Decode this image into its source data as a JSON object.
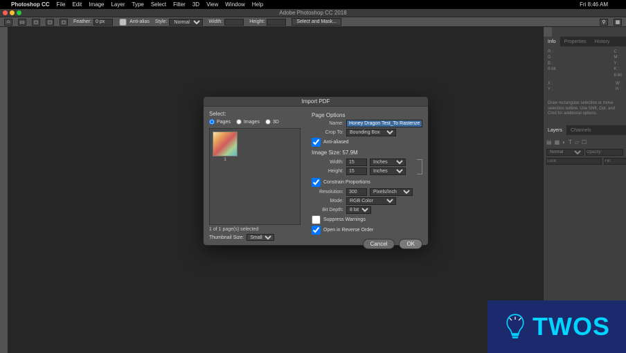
{
  "mac": {
    "apple": "",
    "app": "Photoshop CC",
    "menus": [
      "File",
      "Edit",
      "Image",
      "Layer",
      "Type",
      "Select",
      "Filter",
      "3D",
      "View",
      "Window",
      "Help"
    ],
    "right": [
      "",
      "",
      "",
      "",
      "",
      "",
      "Fri 8:46 AM",
      "",
      ""
    ]
  },
  "doc_title": "Adobe Photoshop CC 2018",
  "options_bar": {
    "feather_label": "Feather:",
    "feather_value": "0 px",
    "antialias_label": "Anti-alias",
    "style_label": "Style:",
    "style_value": "Normal",
    "width_label": "Width:",
    "height_label": "Height:",
    "select_mask": "Select and Mask..."
  },
  "info_panel": {
    "tabs": [
      "Info",
      "Properties",
      "History"
    ],
    "r": "R :",
    "g": "G :",
    "b": "B :",
    "eight": "8-bit",
    "c": "C :",
    "m": "M :",
    "y": "Y :",
    "k": "K :",
    "x": "X :",
    "yy": "Y :",
    "w": "W :",
    "h": "H :",
    "hint": "Draw rectangular selection or move selection outline. Use Shift, Opt, and Cmd for additional options."
  },
  "layers_panel": {
    "tabs": [
      "Layers",
      "Channels"
    ],
    "blend": "Normal",
    "opacity_label": "Opacity:",
    "lock_label": "Lock:",
    "fill_label": "Fill:"
  },
  "dialog": {
    "title": "Import PDF",
    "select_label": "Select:",
    "radios": [
      "Pages",
      "Images",
      "3D"
    ],
    "selected_radio": "Pages",
    "thumb_page": "1",
    "pages_info": "1 of 1 page(s) selected",
    "thumb_size_label": "Thumbnail Size:",
    "thumb_size_value": "Small",
    "page_options_label": "Page Options",
    "name_label": "Name:",
    "name_value": "Honey Dragon Test_To Rasterize.",
    "crop_label": "Crop To:",
    "crop_value": "Bounding Box",
    "antialiased_label": "Anti-aliased",
    "antialiased_checked": true,
    "image_size_label": "Image Size: 57.9M",
    "width_label": "Width:",
    "width_value": "15",
    "width_unit": "Inches",
    "height_label": "Height:",
    "height_value": "15",
    "height_unit": "Inches",
    "constrain_label": "Constrain Proportions",
    "constrain_checked": true,
    "resolution_label": "Resolution:",
    "resolution_value": "300",
    "resolution_unit": "Pixels/Inch",
    "mode_label": "Mode:",
    "mode_value": "RGB Color",
    "bitdepth_label": "Bit Depth:",
    "bitdepth_value": "8 bit",
    "suppress_label": "Suppress Warnings",
    "suppress_checked": false,
    "reverse_label": "Open in Reverse Order",
    "reverse_checked": true,
    "cancel": "Cancel",
    "ok": "OK"
  },
  "logo_text": "TWOS"
}
